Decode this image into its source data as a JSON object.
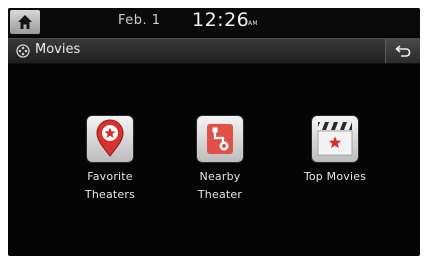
{
  "status": {
    "home_icon": "home-icon",
    "date": "Feb.  1",
    "time": "12:26",
    "ampm": "AM"
  },
  "titlebar": {
    "title": "Movies",
    "title_icon": "movie-reel-icon",
    "back_icon": "back-arrow-icon"
  },
  "menu": {
    "items": [
      {
        "label_line1": "Favorite",
        "label_line2": "Theaters",
        "icon": "favorite-pin-icon"
      },
      {
        "label_line1": "Nearby",
        "label_line2": "Theater",
        "icon": "nearby-route-icon"
      },
      {
        "label_line1": "Top Movies",
        "label_line2": "",
        "icon": "clapperboard-star-icon"
      }
    ]
  },
  "colors": {
    "background": "#050505",
    "accent_red": "#d8322e",
    "text": "#e6e6e6"
  }
}
